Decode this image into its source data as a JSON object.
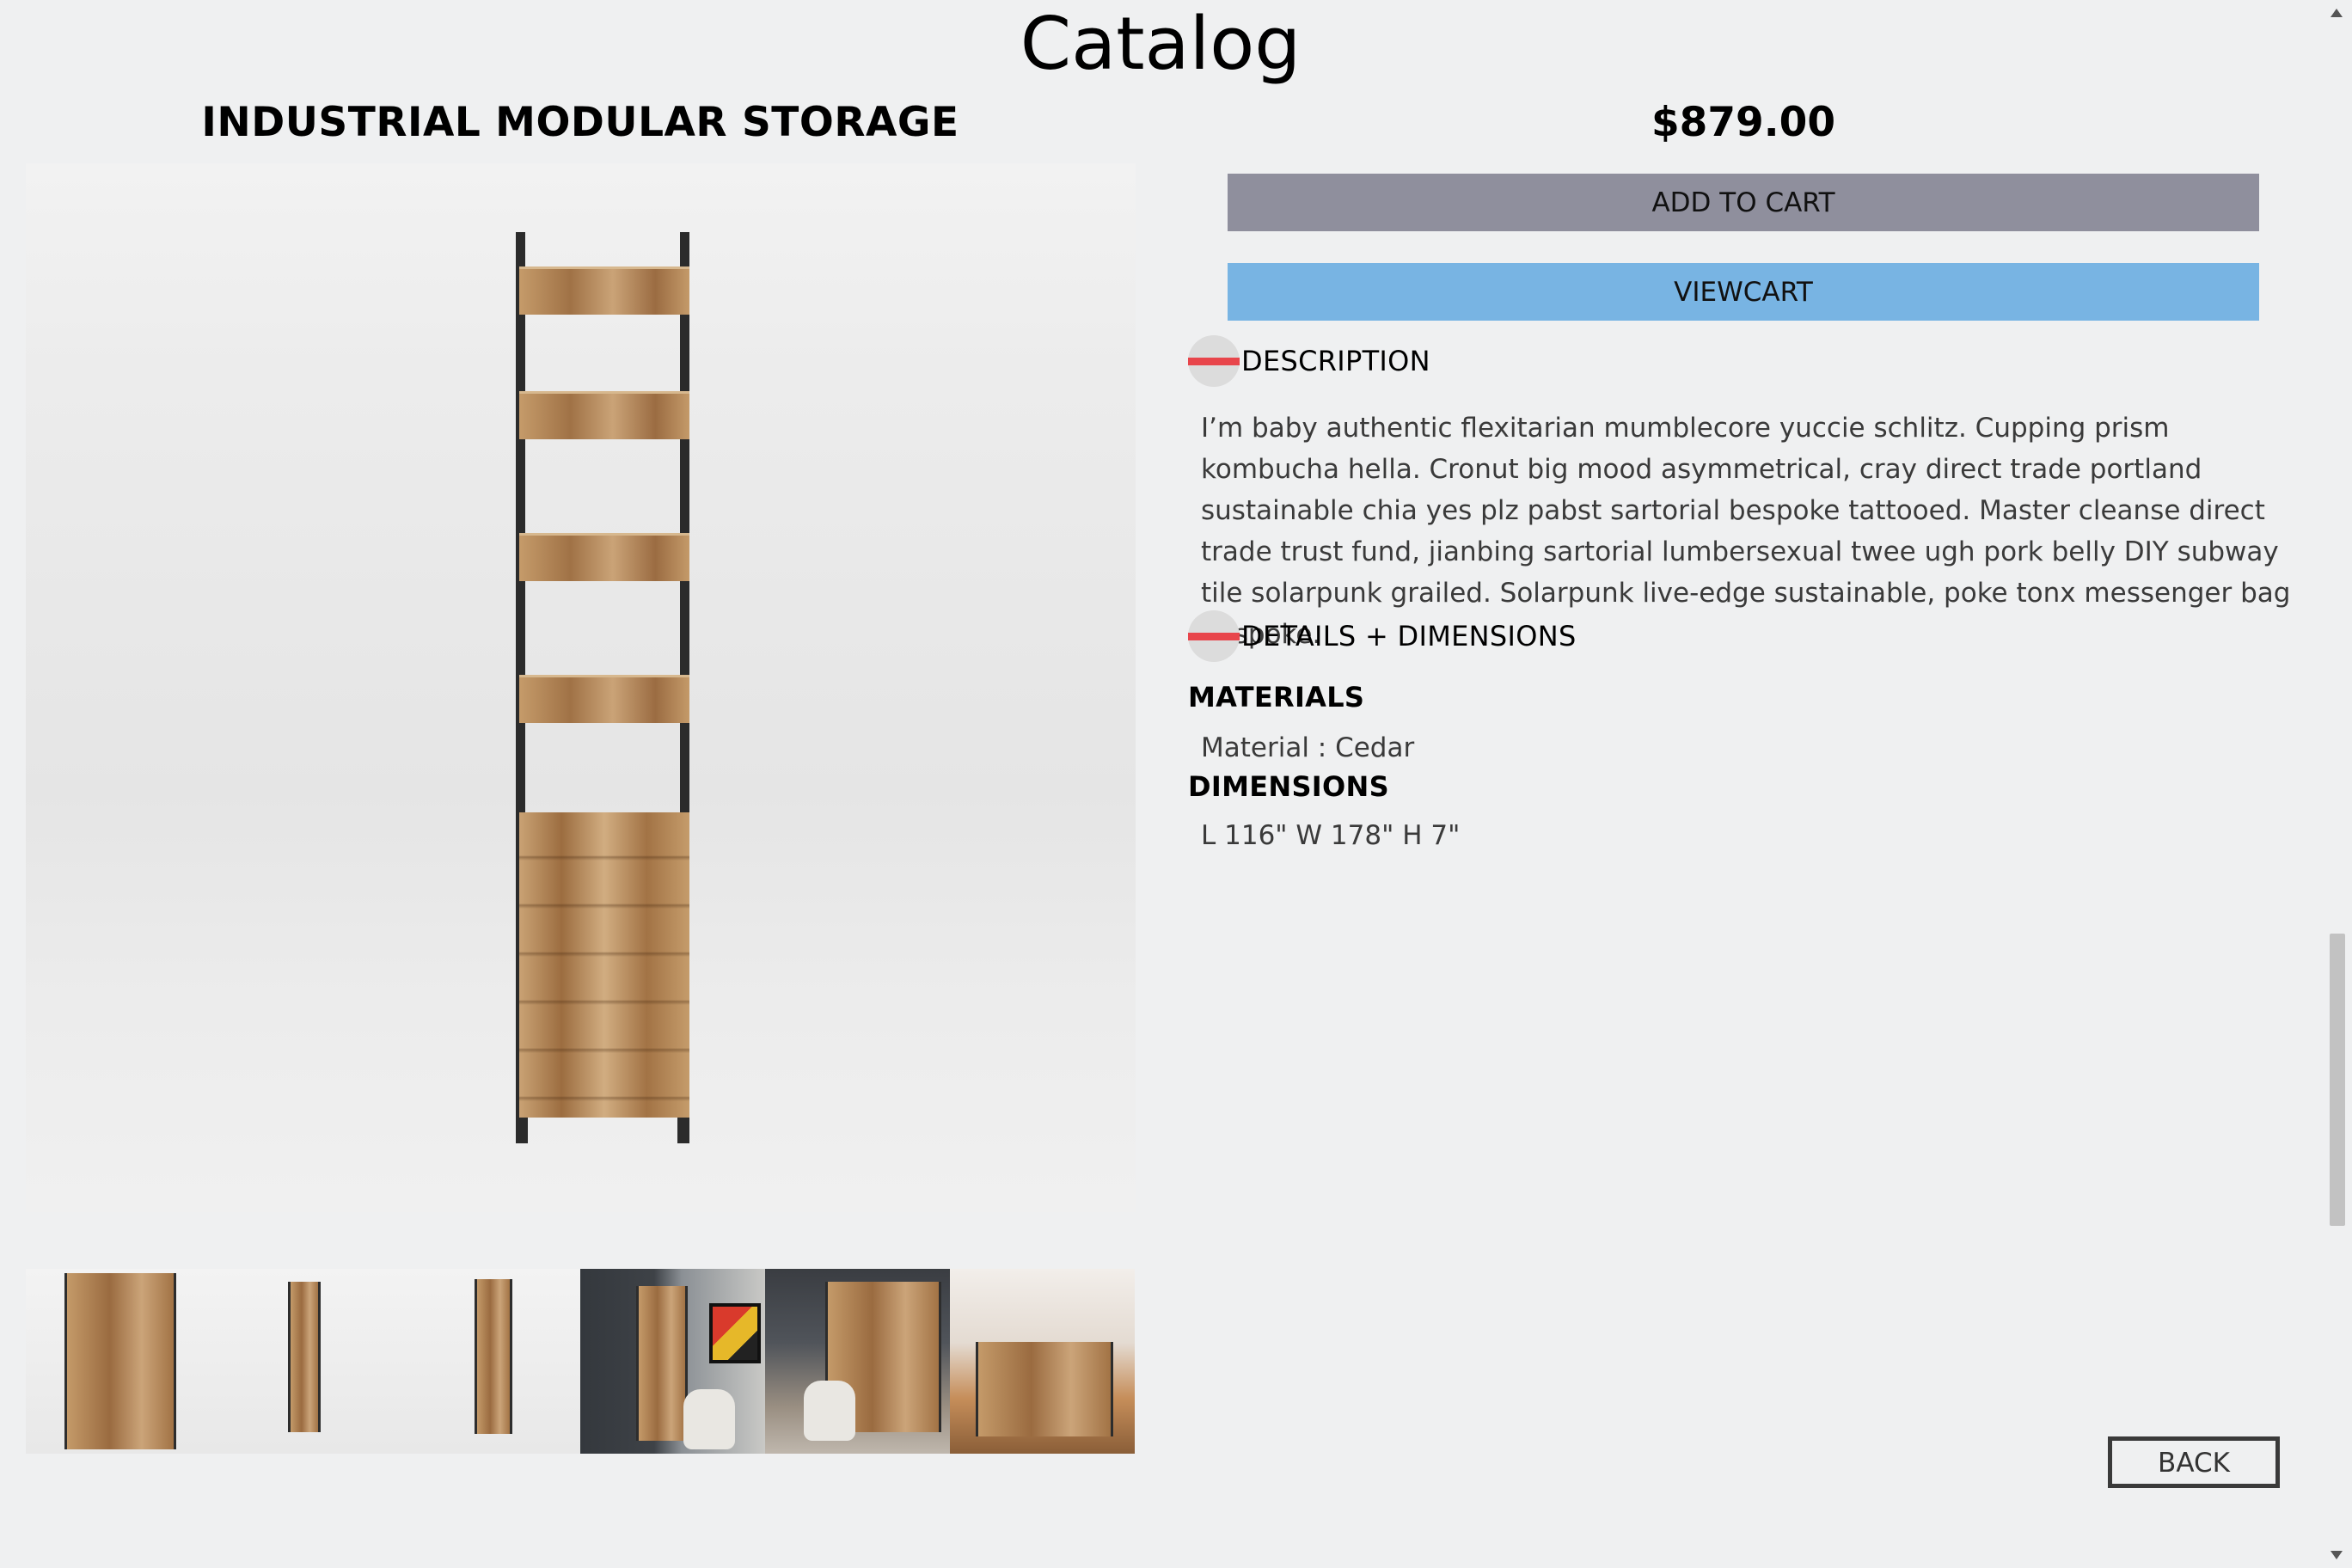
{
  "header": {
    "title": "Catalog"
  },
  "product": {
    "name": "INDUSTRIAL MODULAR STORAGE",
    "price": "$879.00",
    "main_image_alt": "industrial-modular-storage-image",
    "thumbnails": [
      {
        "name": "thumbnail-cabinet"
      },
      {
        "name": "thumbnail-tall-unit"
      },
      {
        "name": "thumbnail-shelf-unit"
      },
      {
        "name": "thumbnail-room-office"
      },
      {
        "name": "thumbnail-room-desk"
      },
      {
        "name": "thumbnail-room-living"
      }
    ]
  },
  "actions": {
    "add_to_cart": "ADD TO CART",
    "view_cart": "VIEWCART",
    "back": "BACK"
  },
  "sections": {
    "description": {
      "label": "DESCRIPTION",
      "text": "I’m baby authentic flexitarian mumblecore yuccie schlitz. Cupping prism kombucha hella. Cronut big mood asymmetrical, cray direct trade portland sustainable chia yes plz pabst sartorial bespoke tattooed. Master cleanse direct trade trust fund, jianbing sartorial lumbersexual twee ugh pork belly DIY subway tile solarpunk grailed. Solarpunk live-edge sustainable, poke tonx messenger bag bespoke."
    },
    "details": {
      "label": "DETAILS + DIMENSIONS",
      "materials_heading": "MATERIALS",
      "material_value": "Material : Cedar",
      "dimensions_heading": "DIMENSIONS",
      "dimension_value": "L 116\" W 178\" H 7\""
    }
  },
  "colors": {
    "background": "#eff0f1",
    "add_to_cart_bg": "#8f8f9d",
    "view_cart_bg": "#78b4e3",
    "collapse_icon": "#e8454b"
  }
}
